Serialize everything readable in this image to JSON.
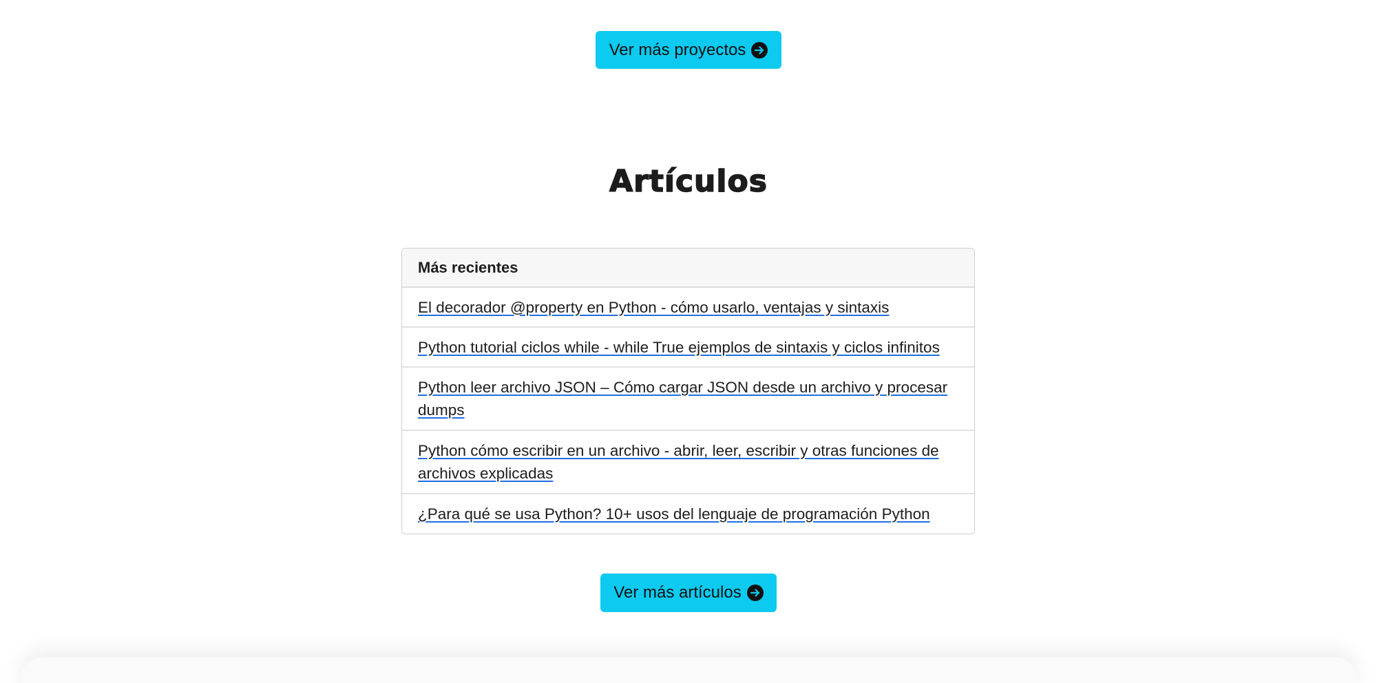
{
  "projects_button": {
    "label": "Ver más proyectos",
    "icon": "arrow-right-circle-icon"
  },
  "articles_section": {
    "title": "Artículos",
    "card_header": "Más recientes",
    "items": [
      {
        "label": "El decorador @property en Python - cómo usarlo, ventajas y sintaxis"
      },
      {
        "label": "Python tutorial ciclos while - while True ejemplos de sintaxis y ciclos infinitos"
      },
      {
        "label": "Python leer archivo JSON – Cómo cargar JSON desde un archivo y procesar dumps"
      },
      {
        "label": "Python cómo escribir en un archivo - abrir, leer, escribir y otras funciones de archivos explicadas"
      },
      {
        "label": "¿Para qué se usa Python? 10+ usos del lenguaje de programación Python"
      }
    ]
  },
  "articles_button": {
    "label": "Ver más artículos",
    "icon": "arrow-right-circle-icon"
  },
  "colors": {
    "button_bg": "#0dcaf0",
    "link_underline": "#1f6fe0",
    "card_header_bg": "#f7f7f7"
  }
}
